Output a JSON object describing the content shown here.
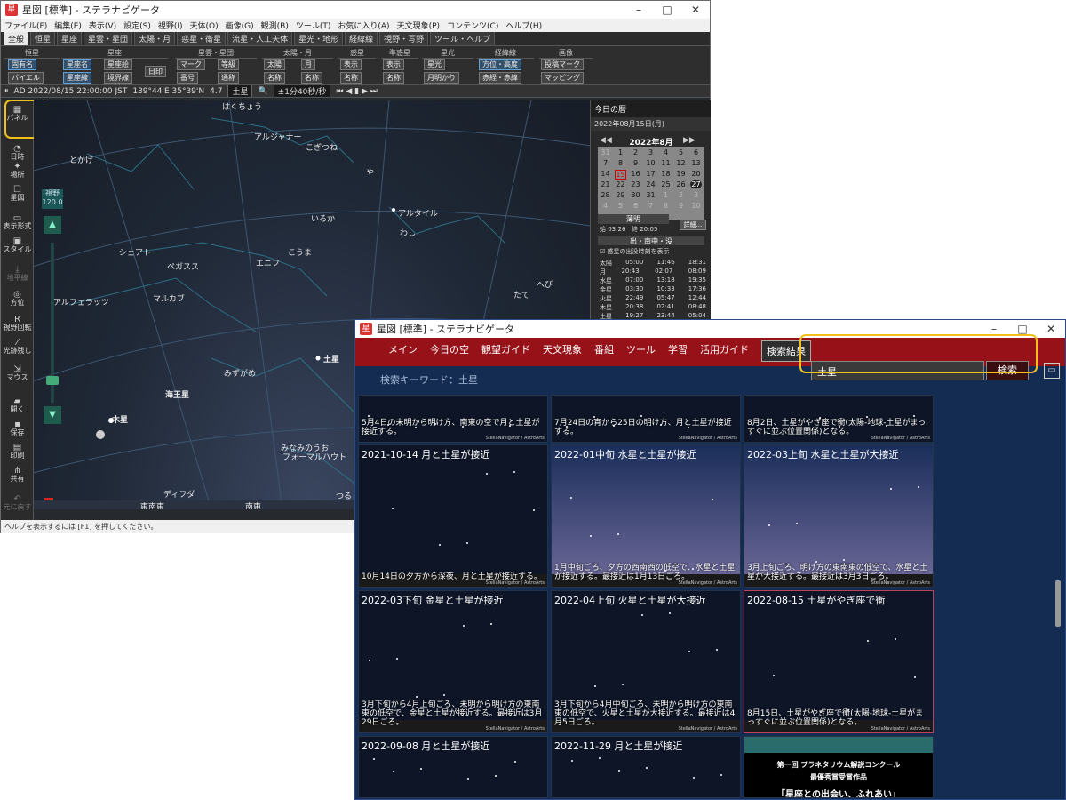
{
  "main_window": {
    "title": "星図 [標準] - ステラナビゲータ",
    "controls": [
      "–",
      "□",
      "✕"
    ],
    "menu": [
      "ファイル(F)",
      "編集(E)",
      "表示(V)",
      "設定(S)",
      "視野(I)",
      "天体(O)",
      "画像(G)",
      "観測(B)",
      "ツール(T)",
      "お気に入り(A)",
      "天文現象(P)",
      "コンテンツ(C)",
      "ヘルプ(H)"
    ],
    "tabs": [
      "全般",
      "恒星",
      "星座",
      "星雲・星団",
      "太陽・月",
      "惑星・衛星",
      "流星・人工天体",
      "星光・地形",
      "経緯線",
      "視野・写野",
      "ツール・ヘルプ"
    ],
    "ribbon": {
      "groups": [
        "恒星",
        "星座",
        "星雲・星団",
        "太陽・月",
        "惑星",
        "準惑星",
        "星光",
        "経緯線",
        "画像"
      ],
      "buttons": [
        "固有名",
        "バイエル",
        "星座名",
        "星座線",
        "星座絵",
        "境界線",
        "日印",
        "マーク",
        "番号",
        "等級",
        "通称",
        "太陽",
        "名称",
        "月",
        "名称",
        "表示",
        "名称",
        "表示",
        "名称",
        "星光",
        "月明かり",
        "方位・高度",
        "赤経・赤緯",
        "投稿マーク",
        "マッピング"
      ]
    },
    "statusbar": {
      "date": "AD 2022/08/15 22:00:00 JST",
      "location": "139°44'E 35°39'N",
      "mag": "4.7",
      "target": "土星",
      "step": "±1分40秒/秒"
    },
    "left_tools": [
      "パネル",
      "日時",
      "場所",
      "星図",
      "表示形式",
      "スタイル",
      "地平線",
      "方位",
      "視野回転",
      "光跡残し",
      "マウス",
      "開く",
      "保存",
      "印刷",
      "共有",
      "元に戻す"
    ],
    "fov": {
      "label": "視野",
      "value": "120.0"
    },
    "sky_labels": [
      "はくちょう",
      "アルジャナー",
      "こぎつね",
      "とかげ",
      "や",
      "アルタイル",
      "いるか",
      "わし",
      "シェアト",
      "ペガスス",
      "エニフ",
      "こうま",
      "マルカブ",
      "へび",
      "アルフェラッツ",
      "たて",
      "土星",
      "みずがめ",
      "海王星",
      "木星",
      "みなみのうお",
      "フォーマルハウト",
      "ディフダ",
      "つる",
      "東南東",
      "南東"
    ],
    "panel": {
      "title": "今日の暦",
      "date": "2022年08月15日(月)",
      "month": "2022年8月",
      "calendar_rows": [
        [
          "31",
          "1",
          "2",
          "3",
          "4",
          "5",
          "6"
        ],
        [
          "7",
          "8",
          "9",
          "10",
          "11",
          "12",
          "13"
        ],
        [
          "14",
          "15",
          "16",
          "17",
          "18",
          "19",
          "20"
        ],
        [
          "21",
          "22",
          "23",
          "24",
          "25",
          "26",
          "27"
        ],
        [
          "28",
          "29",
          "30",
          "31",
          "1",
          "2",
          "3"
        ],
        [
          "4",
          "5",
          "6",
          "7",
          "8",
          "9",
          "10"
        ]
      ],
      "twilight_label": "薄明",
      "twilight_start": "始 03:26",
      "twilight_end": "終 20:05",
      "detail_btn": "詳細...",
      "rise_label": "出・南中・没",
      "rise_note": "惑星の出没時刻を表示",
      "planets": [
        [
          "太陽",
          "05:00",
          "11:46",
          "18:31"
        ],
        [
          "月",
          "20:43",
          "02:07",
          "08:09"
        ],
        [
          "水星",
          "07:00",
          "13:18",
          "19:35"
        ],
        [
          "金星",
          "03:30",
          "10:33",
          "17:36"
        ],
        [
          "火星",
          "22:49",
          "05:47",
          "12:44"
        ],
        [
          "木星",
          "20:38",
          "02:41",
          "08:48"
        ],
        [
          "土星",
          "19:27",
          "23:44",
          "05:04"
        ]
      ]
    },
    "help_text": "ヘルプを表示するには [F1] を押してください。"
  },
  "search_window": {
    "title": "星図 [標準] - ステラナビゲータ",
    "controls": [
      "–",
      "□",
      "✕"
    ],
    "nav": [
      "メイン",
      "今日の空",
      "観望ガイド",
      "天文現象",
      "番組",
      "ツール",
      "学習",
      "活用ガイド",
      "検索結果"
    ],
    "search_value": "土星",
    "search_button": "検索",
    "keyword_line": "検索キーワード：土星",
    "credit": "StellaNavigator / AstroArts",
    "cards": [
      {
        "title": "",
        "desc": "5月4日の未明から明け方、南東の空で月と土星が接近する。"
      },
      {
        "title": "",
        "desc": "7月24日の宵から25日の明け方、月と土星が接近する。"
      },
      {
        "title": "",
        "desc": "8月2日、土星がやぎ座で衝(太陽-地球-土星がまっすぐに並ぶ位置関係)となる。"
      },
      {
        "title": "2021-10-14 月と土星が接近",
        "desc": "10月14日の夕方から深夜、月と土星が接近する。"
      },
      {
        "title": "2022-01中旬 水星と土星が接近",
        "desc": "1月中旬ごろ、夕方の西南西の低空で、水星と土星が接近する。最接近は1月13日ごろ。"
      },
      {
        "title": "2022-03上旬 水星と土星が大接近",
        "desc": "3月上旬ごろ、明け方の東南東の低空で、水星と土星が大接近する。最接近は3月3日ごろ。"
      },
      {
        "title": "2022-03下旬 金星と土星が接近",
        "desc": "3月下旬から4月上旬ごろ、未明から明け方の東南東の低空で、金星と土星が接近する。最接近は3月29日ごろ。"
      },
      {
        "title": "2022-04上旬 火星と土星が大接近",
        "desc": "3月下旬から4月中旬ごろ、未明から明け方の東南東の低空で、火星と土星が大接近する。最接近は4月5日ごろ。"
      },
      {
        "title": "2022-08-15 土星がやぎ座で衝",
        "desc": "8月15日、土星がやぎ座で衝(太陽-地球-土星がまっすぐに並ぶ位置関係)となる。"
      },
      {
        "title": "2022-09-08 月と土星が接近",
        "desc": ""
      },
      {
        "title": "2022-11-29 月と土星が接近",
        "desc": ""
      },
      {
        "title": "第一回 プラネタリウム解説コンクール",
        "desc": "最優秀賞受賞作品",
        "extra": "「星座との出会い、ふれあい」"
      }
    ]
  }
}
